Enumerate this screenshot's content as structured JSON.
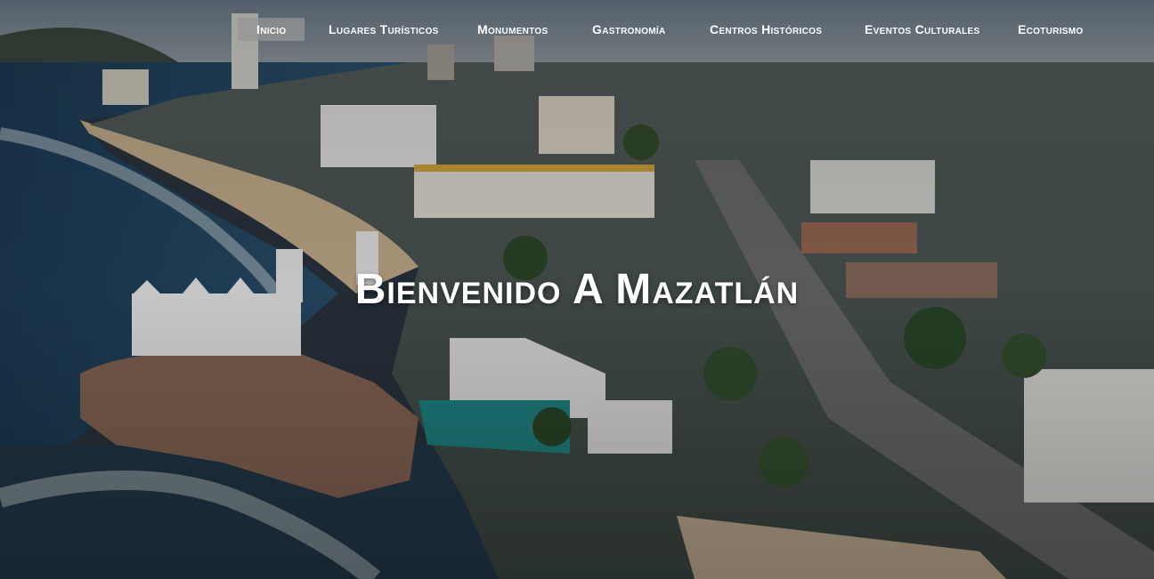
{
  "nav": {
    "items": [
      {
        "label": "Inicio",
        "active": true
      },
      {
        "label": "Lugares Turísticos",
        "active": false
      },
      {
        "label": "Monumentos",
        "active": false
      },
      {
        "label": "Gastronomía",
        "active": false
      },
      {
        "label": "Centros Históricos",
        "active": false
      },
      {
        "label": "Eventos Culturales",
        "active": false
      },
      {
        "label": "Ecoturismo",
        "active": false
      }
    ]
  },
  "hero": {
    "title": "Bienvenido A Mazatlán",
    "background_image": "aerial-view-of-mazatlan-coastline"
  },
  "colors": {
    "nav_text": "#ffffff",
    "nav_active_bg": "#969696",
    "title_text": "#ffffff",
    "overlay": "#000000"
  }
}
